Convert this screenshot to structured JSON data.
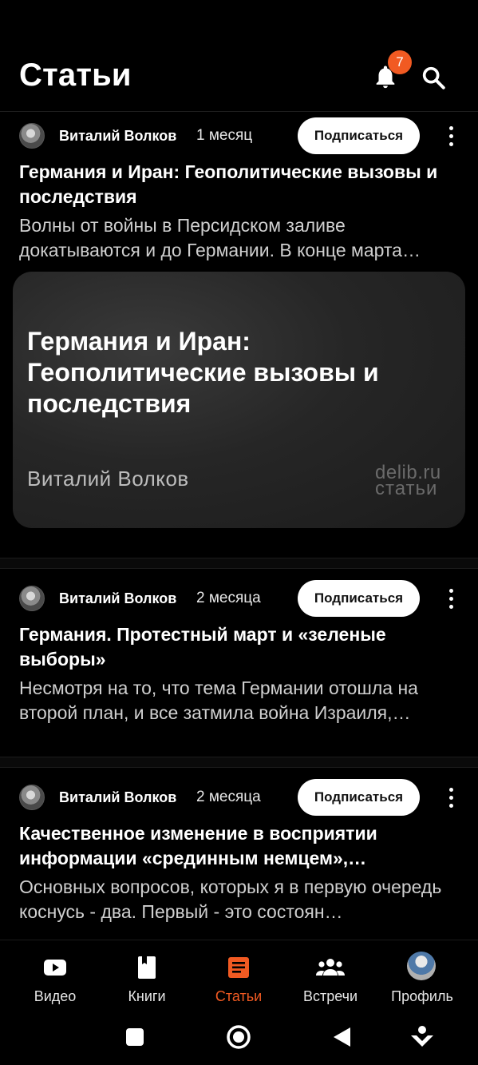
{
  "header": {
    "title": "Статьи",
    "notification_count": "7"
  },
  "articles": [
    {
      "author": "Виталий Волков",
      "age": "1 месяц",
      "subscribe_label": "Подписаться",
      "title": "Германия и Иран: Геополитические вызовы и последствия",
      "excerpt": "Волны от войны в Персидском заливе докатываются и до Германии. В конце марта…",
      "cover": {
        "title": "Германия и Иран: Геополитические вызовы и последствия",
        "author": "Виталий Волков",
        "watermark_line1": "delib.ru",
        "watermark_line2": "статьи"
      }
    },
    {
      "author": "Виталий Волков",
      "age": "2 месяца",
      "subscribe_label": "Подписаться",
      "title": "Германия. Протестный март и «зеленые выборы»",
      "excerpt": "Несмотря на то, что тема Германии отошла на второй план, и все затмила война Израиля,…"
    },
    {
      "author": "Виталий Волков",
      "age": "2 месяца",
      "subscribe_label": "Подписаться",
      "title": "Качественное изменение в восприятии информации «срединным немцем»,…",
      "excerpt": "Основных вопросов, которых я в первую очередь коснусь - два. Первый - это состоян…"
    }
  ],
  "bottom_nav": [
    {
      "label": "Видео",
      "icon": "video-icon",
      "active": false
    },
    {
      "label": "Книги",
      "icon": "book-icon",
      "active": false
    },
    {
      "label": "Статьи",
      "icon": "articles-icon",
      "active": true
    },
    {
      "label": "Встречи",
      "icon": "people-icon",
      "active": false
    },
    {
      "label": "Профиль",
      "icon": "profile-avatar",
      "active": false
    }
  ],
  "colors": {
    "accent": "#f15a22",
    "background": "#000000",
    "text": "#ffffff"
  }
}
